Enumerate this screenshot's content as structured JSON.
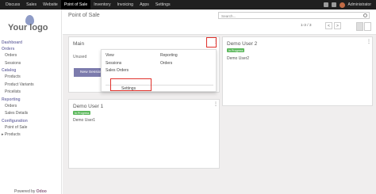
{
  "topbar": {
    "items": [
      "Discuss",
      "Sales",
      "Website",
      "Point of Sale",
      "Inventory",
      "Invoicing",
      "Apps",
      "Settings"
    ],
    "active": "Point of Sale",
    "user": "Administrator"
  },
  "sidebar": {
    "logo": "Your logo",
    "sections": [
      {
        "title": "Dashboard",
        "items": []
      },
      {
        "title": "Orders",
        "items": [
          "Orders",
          "Sessions"
        ]
      },
      {
        "title": "Catalog",
        "items": [
          "Products",
          "Product Variants",
          "Pricelists"
        ]
      },
      {
        "title": "Reporting",
        "items": [
          "Orders",
          "Sales Details"
        ]
      },
      {
        "title": "Configuration",
        "items": [
          "Point of Sale",
          "Products"
        ]
      }
    ],
    "powered_prefix": "Powered by",
    "powered_brand": "Odoo"
  },
  "control_panel": {
    "title": "Point of Sale",
    "search_placeholder": "Search...",
    "pager": "1-3 / 3",
    "prev": "<",
    "next": ">"
  },
  "cards": {
    "main": {
      "name": "Main",
      "status": "Unused",
      "button": "New Session"
    },
    "demo2": {
      "name": "Demo User 2",
      "badge": "In Progress",
      "user": "Demo User2"
    },
    "demo1": {
      "name": "Demo User 1",
      "badge": "In Progress",
      "user": "Demo User1"
    }
  },
  "dropdown": {
    "view_title": "View",
    "view_items": [
      "Sessions",
      "Sales Orders"
    ],
    "reporting_title": "Reporting",
    "reporting_items": [
      "Orders"
    ],
    "settings": "Settings"
  },
  "colors": {
    "accent": "#7c7bad",
    "badge": "#5cb85c",
    "highlight": "#e0312b",
    "topbar": "#1f1f1f"
  }
}
